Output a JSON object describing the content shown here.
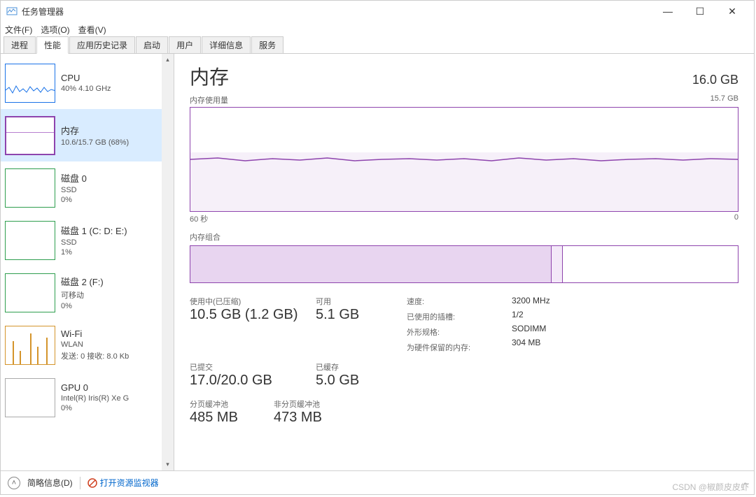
{
  "window": {
    "title": "任务管理器"
  },
  "menu": {
    "file": "文件(F)",
    "options": "选项(O)",
    "view": "查看(V)"
  },
  "tabs": {
    "processes": "进程",
    "performance": "性能",
    "app_history": "应用历史记录",
    "startup": "启动",
    "users": "用户",
    "details": "详细信息",
    "services": "服务"
  },
  "sidebar": [
    {
      "title": "CPU",
      "sub": "40% 4.10 GHz",
      "sub2": ""
    },
    {
      "title": "内存",
      "sub": "10.6/15.7 GB (68%)",
      "sub2": ""
    },
    {
      "title": "磁盘 0",
      "sub": "SSD",
      "sub2": "0%"
    },
    {
      "title": "磁盘 1 (C: D: E:)",
      "sub": "SSD",
      "sub2": "1%"
    },
    {
      "title": "磁盘 2 (F:)",
      "sub": "可移动",
      "sub2": "0%"
    },
    {
      "title": "Wi-Fi",
      "sub": "WLAN",
      "sub2": "发送: 0 接收: 8.0 Kb"
    },
    {
      "title": "GPU 0",
      "sub": "Intel(R) Iris(R) Xe G",
      "sub2": "0%"
    }
  ],
  "main": {
    "title": "内存",
    "total": "16.0 GB",
    "usage_label": "内存使用量",
    "usage_max": "15.7 GB",
    "axis_left": "60 秒",
    "axis_right": "0",
    "comp_label": "内存组合"
  },
  "stats": {
    "in_use_lbl": "使用中(已压缩)",
    "in_use_val": "10.5 GB (1.2 GB)",
    "avail_lbl": "可用",
    "avail_val": "5.1 GB",
    "committed_lbl": "已提交",
    "committed_val": "17.0/20.0 GB",
    "cached_lbl": "已缓存",
    "cached_val": "5.0 GB",
    "paged_lbl": "分页缓冲池",
    "paged_val": "485 MB",
    "nonpaged_lbl": "非分页缓冲池",
    "nonpaged_val": "473 MB",
    "speed_lbl": "速度:",
    "speed_val": "3200 MHz",
    "slots_lbl": "已使用的插槽:",
    "slots_val": "1/2",
    "form_lbl": "外形规格:",
    "form_val": "SODIMM",
    "hw_lbl": "为硬件保留的内存:",
    "hw_val": "304 MB"
  },
  "footer": {
    "fewer": "简略信息(D)",
    "resmon": "打开资源监视器"
  },
  "watermark": "CSDN @椒颜皮皮虾໌",
  "chart_data": {
    "type": "line",
    "title": "内存使用量",
    "xlabel": "秒",
    "ylabel": "GB",
    "x_range": [
      60,
      0
    ],
    "ylim": [
      0,
      15.7
    ],
    "series": [
      {
        "name": "内存",
        "approx_value": 10.6,
        "note": "roughly flat ~10.6 GB across the 60s window"
      }
    ],
    "composition": {
      "in_use_gb": 10.5,
      "modified_gb": 0.2,
      "standby_free_gb": 5.1,
      "total_gb": 15.7
    }
  }
}
